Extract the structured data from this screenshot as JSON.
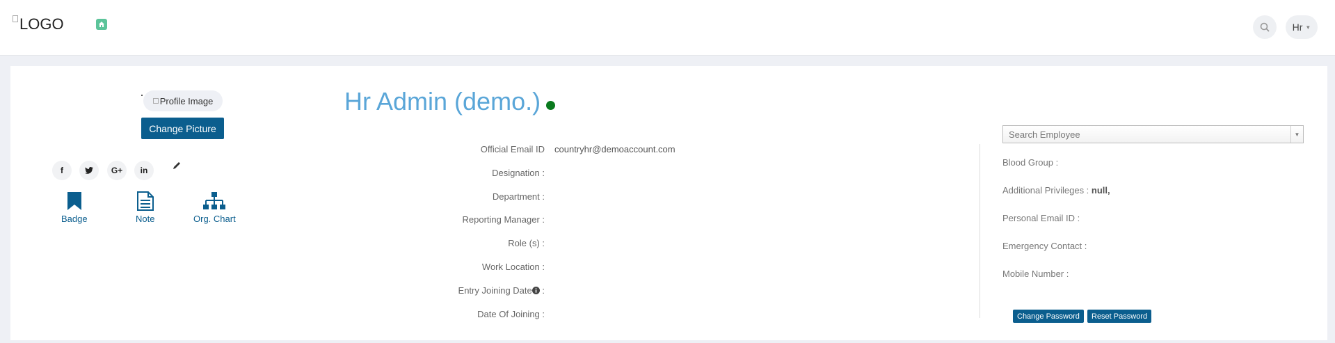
{
  "header": {
    "logo_alt": "LOGO",
    "user_menu_label": "Hr"
  },
  "profile": {
    "image_alt": "Profile Image",
    "change_picture_label": "Change Picture",
    "social": [
      {
        "icon": "facebook-icon",
        "glyph": "f"
      },
      {
        "icon": "twitter-icon",
        "glyph": "🐦"
      },
      {
        "icon": "google-plus-icon",
        "glyph": "G+"
      },
      {
        "icon": "linkedin-icon",
        "glyph": "in"
      }
    ],
    "quick_links": [
      {
        "label": "Badge",
        "icon": "bookmark-icon"
      },
      {
        "label": "Note",
        "icon": "document-icon"
      },
      {
        "label": "Org. Chart",
        "icon": "org-chart-icon"
      }
    ]
  },
  "employee": {
    "name": "Hr Admin (demo.)",
    "status_color": "#0a7a1e",
    "fields": [
      {
        "label": "Official Email ID",
        "value": "countryhr@demoaccount.com"
      },
      {
        "label": "Designation :",
        "value": ""
      },
      {
        "label": "Department :",
        "value": ""
      },
      {
        "label": "Reporting Manager :",
        "value": ""
      },
      {
        "label": "Role (s) :",
        "value": ""
      },
      {
        "label": "Work Location :",
        "value": ""
      },
      {
        "label": "Entry Joining Date",
        "value": "",
        "info_suffix": " :"
      },
      {
        "label": "Date Of Joining :",
        "value": ""
      }
    ]
  },
  "right_panel": {
    "search_placeholder": "Search Employee",
    "blood_group_label": "Blood Group :",
    "additional_privileges_label": "Additional Privileges :",
    "additional_privileges_value": "null,",
    "personal_email_label": "Personal Email ID :",
    "emergency_contact_label": "Emergency Contact :",
    "mobile_number_label": "Mobile Number :",
    "change_password_label": "Change Password",
    "reset_password_label": "Reset Password"
  },
  "colors": {
    "accent": "#0b5e8e",
    "name": "#5aa6d8",
    "home": "#5cc49a"
  }
}
